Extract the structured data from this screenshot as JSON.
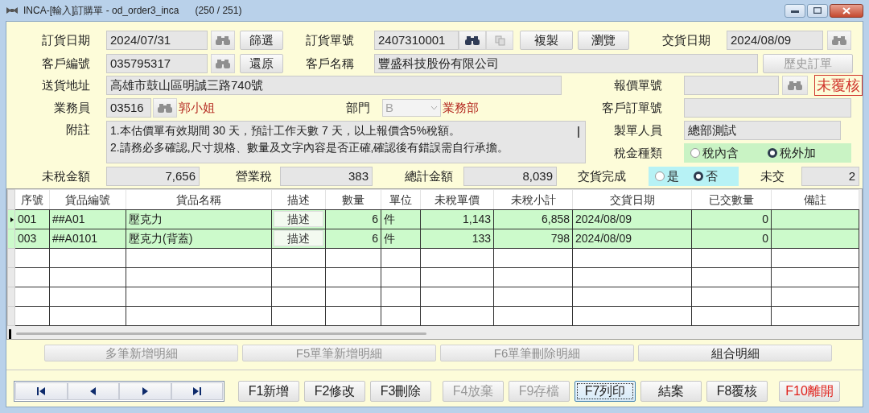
{
  "window": {
    "title": "INCA-[輸入]訂購單 - od_order3_inca",
    "counter": "(250 / 251)"
  },
  "form": {
    "order_date": {
      "label": "訂貨日期",
      "value": "2024/07/31"
    },
    "filter_button": "篩選",
    "order_no": {
      "label": "訂貨單號",
      "value": "2407310001"
    },
    "copy_button": "複製",
    "browse_button": "瀏覽",
    "delivery_date": {
      "label": "交貨日期",
      "value": "2024/08/09"
    },
    "customer_no": {
      "label": "客戶編號",
      "value": "035795317"
    },
    "restore_button": "還原",
    "customer_name": {
      "label": "客戶名稱",
      "value": "豐盛科技股份有限公司"
    },
    "history_button": {
      "label": "歷史訂單",
      "disabled": true
    },
    "address": {
      "label": "送貨地址",
      "value": "高雄市鼓山區明誠三路740號"
    },
    "quote_no": {
      "label": "報價單號"
    },
    "status_stamp": "未覆核",
    "salesperson": {
      "label": "業務員",
      "value": "03516",
      "name": "郭小姐"
    },
    "department": {
      "label": "部門",
      "value": "B",
      "name": "業務部",
      "disabled": true
    },
    "customer_order_no": {
      "label": "客戶訂單號"
    },
    "note": {
      "label": "附註",
      "lines": [
        "1.本估價單有效期間 30 天，預計工作天數 7 天，以上報價含5%稅額。",
        "2.請務必多確認,尺寸規格、數量及文字內容是否正確,確認後有錯誤需自行承擔。"
      ]
    },
    "creator": {
      "label": "製單人員",
      "value": "總部測試"
    },
    "tax_type": {
      "label": "稅金種類",
      "options": [
        {
          "label": "稅內含",
          "selected": false
        },
        {
          "label": "稅外加",
          "selected": true
        }
      ]
    },
    "subtotal": {
      "label": "未稅金額",
      "value": "7,656"
    },
    "tax": {
      "label": "營業稅",
      "value": "383"
    },
    "total": {
      "label": "總計金額",
      "value": "8,039"
    },
    "delivered": {
      "label": "交貨完成",
      "options": [
        {
          "label": "是",
          "selected": false
        },
        {
          "label": "否",
          "selected": true
        }
      ]
    },
    "undelivered": {
      "label": "未交",
      "value": "2"
    }
  },
  "table": {
    "columns": [
      "序號",
      "貨品編號",
      "貨品名稱",
      "描述",
      "數量",
      "單位",
      "未稅單價",
      "未稅小計",
      "交貨日期",
      "已交數量",
      "備註"
    ],
    "rows": [
      {
        "current": true,
        "cells": [
          "001",
          "##A01",
          "壓克力",
          "描述",
          "6",
          "件",
          "1,143",
          "6,858",
          "2024/08/09",
          "0",
          ""
        ]
      },
      {
        "current": false,
        "cells": [
          "003",
          "##A0101",
          "壓克力(背蓋)",
          "描述",
          "6",
          "件",
          "133",
          "798",
          "2024/08/09",
          "0",
          ""
        ]
      }
    ]
  },
  "detail_buttons": [
    {
      "label": "多筆新增明細",
      "disabled": true
    },
    {
      "label": "F5單筆新增明細",
      "disabled": true
    },
    {
      "label": "F6單筆刪除明細",
      "disabled": true
    },
    {
      "label": "組合明細",
      "disabled": false
    }
  ],
  "function_buttons": [
    {
      "label": "F1新增",
      "kind": "command",
      "disabled": false,
      "focused": false
    },
    {
      "label": "F2修改",
      "kind": "command",
      "disabled": false,
      "focused": false
    },
    {
      "label": "F3刪除",
      "kind": "command",
      "disabled": false,
      "focused": false
    },
    {
      "label": "F4放棄",
      "kind": "command",
      "disabled": true,
      "focused": false
    },
    {
      "label": "F9存檔",
      "kind": "command",
      "disabled": true,
      "focused": false
    },
    {
      "label": "F7列印",
      "kind": "command",
      "disabled": false,
      "focused": true
    },
    {
      "label": "結案",
      "kind": "command",
      "disabled": false,
      "focused": false
    },
    {
      "label": "F8覆核",
      "kind": "command",
      "disabled": false,
      "focused": false
    },
    {
      "label": "F10離開",
      "kind": "exit",
      "disabled": false,
      "focused": false
    }
  ]
}
